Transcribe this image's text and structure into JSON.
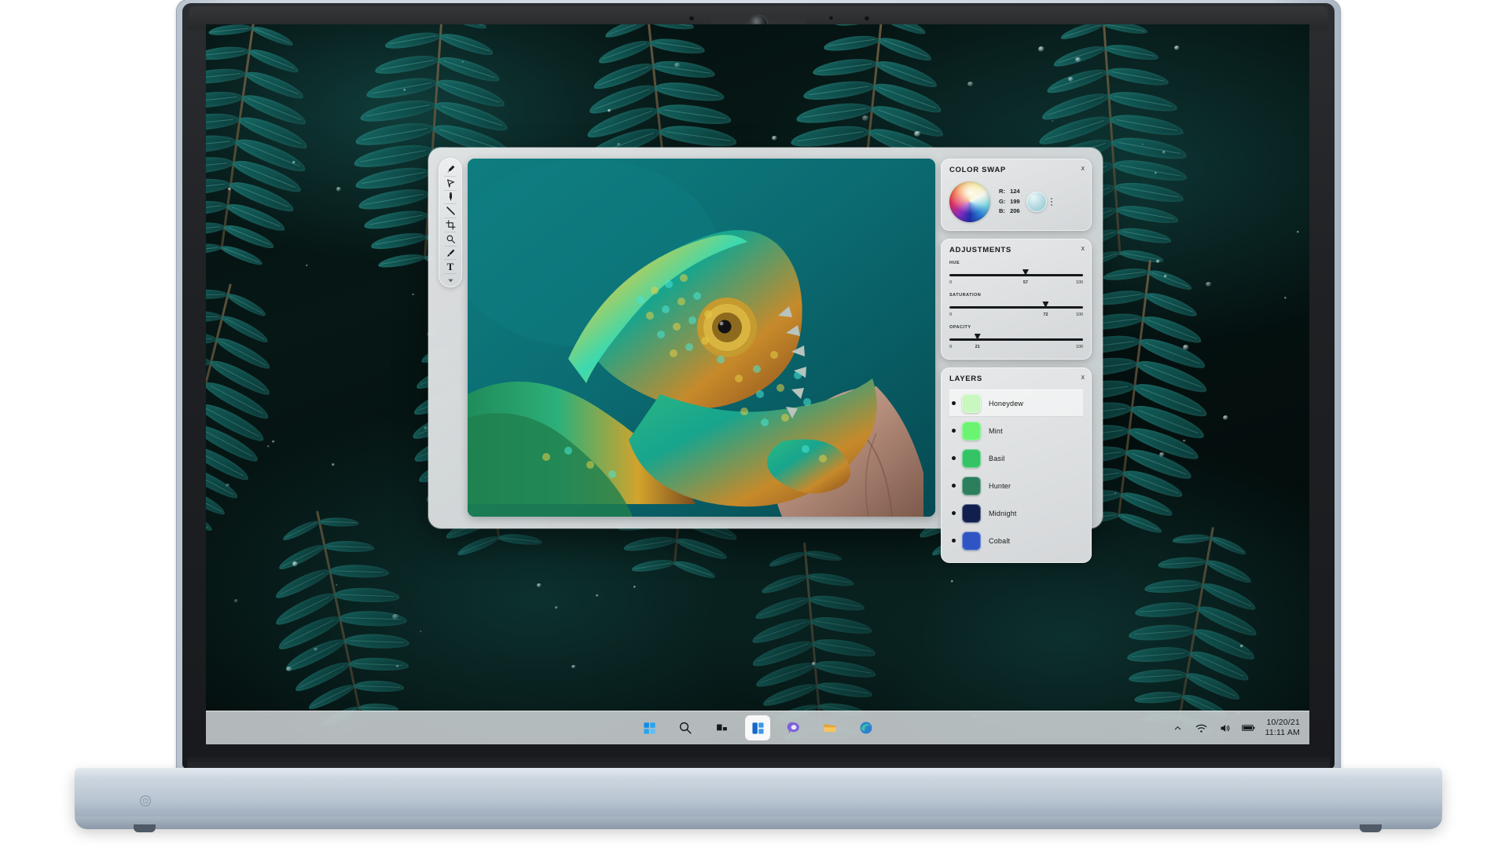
{
  "device": {
    "type": "laptop",
    "camera": "webcam"
  },
  "desktop": {
    "wallpaper_name": "fern-leaves-water-droplets"
  },
  "taskbar": {
    "items": [
      {
        "name": "start-button",
        "icon": "windows-logo-icon",
        "active": false
      },
      {
        "name": "search-button",
        "icon": "search-icon",
        "active": false
      },
      {
        "name": "task-view-button",
        "icon": "task-view-icon",
        "active": false
      },
      {
        "name": "widgets-button",
        "icon": "widgets-icon",
        "active": true
      },
      {
        "name": "chat-button",
        "icon": "chat-icon",
        "active": false
      },
      {
        "name": "file-explorer-button",
        "icon": "folder-icon",
        "active": false
      },
      {
        "name": "edge-button",
        "icon": "edge-icon",
        "active": false
      }
    ],
    "tray": {
      "show_hidden_label": "^",
      "icons": [
        "wifi-icon",
        "volume-icon",
        "battery-icon"
      ],
      "date": "10/20/21",
      "time": "11:11 AM"
    }
  },
  "app": {
    "toolbar": {
      "tools": [
        {
          "name": "brush-tool",
          "glyph": "brush-icon"
        },
        {
          "name": "lasso-tool",
          "glyph": "lasso-icon"
        },
        {
          "name": "marker-tool",
          "glyph": "marker-icon"
        },
        {
          "name": "line-tool",
          "glyph": "line-icon"
        },
        {
          "name": "crop-tool",
          "glyph": "crop-icon"
        },
        {
          "name": "zoom-tool",
          "glyph": "magnifier-icon"
        },
        {
          "name": "eyedropper-tool",
          "glyph": "eyedropper-icon"
        },
        {
          "name": "text-tool",
          "glyph": "text-icon",
          "label": "T"
        },
        {
          "name": "more-tool",
          "glyph": "chevron-down-icon"
        }
      ]
    },
    "canvas": {
      "image_subject": "veiled-chameleon-on-branch",
      "background_color": "#0d7478"
    },
    "panels": {
      "color_swap": {
        "title": "COLOR SWAP",
        "close_label": "x",
        "channels": [
          {
            "label": "R:",
            "value": "124"
          },
          {
            "label": "G:",
            "value": "199"
          },
          {
            "label": "B:",
            "value": "206"
          }
        ],
        "swatch_color": "#aed7de"
      },
      "adjustments": {
        "title": "ADJUSTMENTS",
        "close_label": "x",
        "sliders": [
          {
            "label": "HUE",
            "value": 57,
            "min": "0",
            "max": "100",
            "value_label": "57"
          },
          {
            "label": "SATURATION",
            "value": 72,
            "min": "0",
            "max": "100",
            "value_label": "72"
          },
          {
            "label": "OPACITY",
            "value": 21,
            "min": "0",
            "max": "100",
            "value_label": "21"
          }
        ]
      },
      "layers": {
        "title": "LAYERS",
        "close_label": "x",
        "items": [
          {
            "name": "Honeydew",
            "color": "#c8f7bf",
            "selected": true
          },
          {
            "name": "Mint",
            "color": "#6bf472",
            "selected": false
          },
          {
            "name": "Basil",
            "color": "#35c465",
            "selected": false
          },
          {
            "name": "Hunter",
            "color": "#2b7f5c",
            "selected": false
          },
          {
            "name": "Midnight",
            "color": "#111f4f",
            "selected": false
          },
          {
            "name": "Cobalt",
            "color": "#2f55c4",
            "selected": false
          }
        ]
      }
    }
  }
}
